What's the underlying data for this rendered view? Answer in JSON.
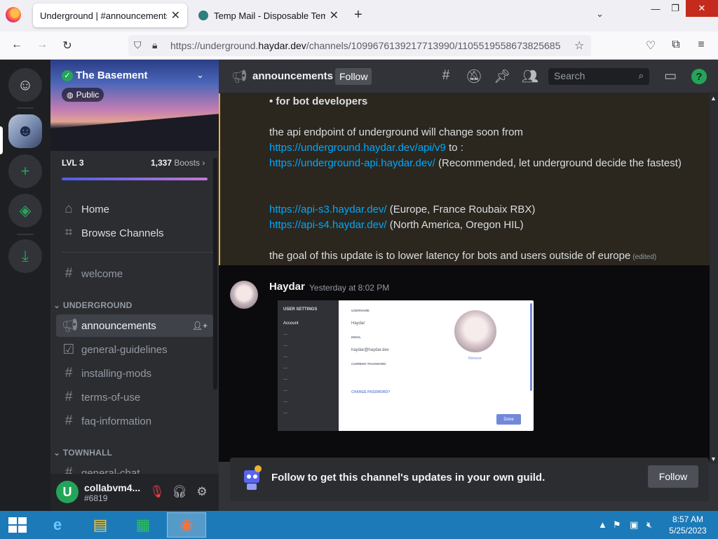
{
  "browser": {
    "tabs": [
      {
        "title": "Underground | #announcements | T",
        "active": true
      },
      {
        "title": "Temp Mail - Disposable Tempor",
        "active": false
      }
    ],
    "url_prefix": "https://underground.",
    "url_host": "haydar.dev",
    "url_path": "/channels/1099676139217713990/1105519558673825685"
  },
  "server": {
    "name": "The Basement",
    "badge": "Public",
    "level": "LVL 3",
    "boost_count": "1,337",
    "boost_label": "Boosts",
    "boost_progress": 1.0,
    "nav": [
      {
        "label": "Home"
      },
      {
        "label": "Browse Channels"
      }
    ],
    "top_channels": [
      {
        "label": "welcome"
      }
    ],
    "categories": [
      {
        "name": "UNDERGROUND",
        "channels": [
          {
            "label": "announcements",
            "type": "announcement",
            "active": true
          },
          {
            "label": "general-guidelines",
            "type": "rules"
          },
          {
            "label": "installing-mods",
            "type": "text"
          },
          {
            "label": "terms-of-use",
            "type": "text"
          },
          {
            "label": "faq-information",
            "type": "text"
          }
        ]
      },
      {
        "name": "TOWNHALL",
        "channels": [
          {
            "label": "general-chat",
            "type": "text"
          }
        ]
      }
    ]
  },
  "user": {
    "name": "collabvm4...",
    "tag": "#6819",
    "initial": "U"
  },
  "channel": {
    "name": "announcements",
    "follow_label": "Follow",
    "search_placeholder": "Search"
  },
  "pinned_message": {
    "heading": "• for bot developers",
    "line1": "the api endpoint of underground will change soon from",
    "link_old": "https://underground.haydar.dev/api/v9",
    "to_text": " to :",
    "link_new": "https://underground-api.haydar.dev/",
    "recommend": " (Recommended, let underground decide the fastest)",
    "link_eu": "https://api-s3.haydar.dev/",
    "eu_text": " (Europe, France Roubaix RBX)",
    "link_na": "https://api-s4.haydar.dev/",
    "na_text": " (North America, Oregon HIL)",
    "goal": "the goal of this update is to lower latency for bots and users outside of europe",
    "edited": "(edited)"
  },
  "message2": {
    "author": "Haydar",
    "timestamp": "Yesterday at 8:02 PM",
    "attachment": {
      "side_title": "USER SETTINGS",
      "side_items": [
        "Account"
      ],
      "label_username": "USERNAME",
      "username": "Haydar",
      "label_email": "EMAIL",
      "email": "haydar@haydar.dev",
      "label_password": "CURRENT PASSWORD",
      "remove": "Remove",
      "change_password": "CHANGE PASSWORD?",
      "done": "Done"
    }
  },
  "follow_prompt": {
    "text": "Follow to get this channel's updates in your own guild.",
    "button": "Follow"
  },
  "taskbar": {
    "time": "8:57 AM",
    "date": "5/25/2023"
  },
  "colors": {
    "accent": "#5865f2",
    "online": "#23a559",
    "link": "#00a8fc",
    "pinned_bar": "#f0b232",
    "taskbar": "#1d7ab8"
  }
}
